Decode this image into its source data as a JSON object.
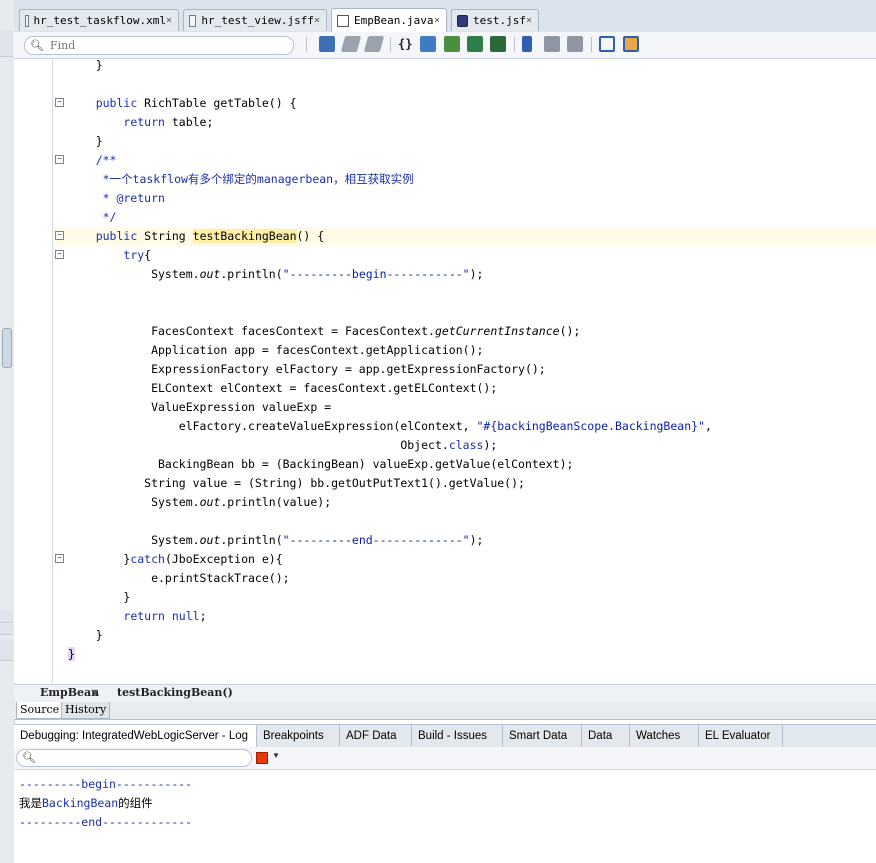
{
  "editor_tabs": [
    {
      "label": "hr_test_taskflow.xml",
      "icon": "xml-file-icon",
      "active": false
    },
    {
      "label": "hr_test_view.jsff",
      "icon": "jsff-file-icon",
      "active": false
    },
    {
      "label": "EmpBean.java",
      "icon": "java-file-icon",
      "active": true
    },
    {
      "label": "test.jsf",
      "icon": "jsf-file-icon",
      "active": false
    }
  ],
  "tab_close_glyph": "×",
  "toolbar": {
    "find_placeholder": "Find",
    "buttons": [
      "toggle-comment-icon",
      "indent-icon",
      "unindent-icon",
      "code-template-icon",
      "surround-icon",
      "refactor-icon",
      "generate-accessors-icon",
      "override-icon",
      "bookmark-icon",
      "next-bookmark-icon",
      "prev-bookmark-icon",
      "show-outline-icon",
      "structure-icon"
    ]
  },
  "code": {
    "lines": [
      "    }",
      "",
      "    public RichTable getTable() {",
      "        return table;",
      "    }",
      "    /**",
      "     *一个taskflow有多个绑定的managerbean，相互获取实例",
      "     * @return",
      "     */",
      "    public String testBackingBean() {",
      "        try{",
      "            System.out.println(\"---------begin-----------\");",
      "",
      "",
      "            FacesContext facesContext = FacesContext.getCurrentInstance();",
      "            Application app = facesContext.getApplication();",
      "            ExpressionFactory elFactory = app.getExpressionFactory();",
      "            ELContext elContext = facesContext.getELContext();",
      "            ValueExpression valueExp =",
      "                elFactory.createValueExpression(elContext, \"#{backingBeanScope.BackingBean}\",",
      "                                                Object.class);",
      "             BackingBean bb = (BackingBean) valueExp.getValue(elContext);",
      "           String value = (String) bb.getOutPutText1().getValue();",
      "            System.out.println(value);",
      "",
      "            System.out.println(\"---------end-------------\");",
      "        }catch(JboException e){",
      "            e.printStackTrace();",
      "        }",
      "        return null;",
      "    }",
      "}"
    ]
  },
  "breadcrumb": [
    "EmpBean",
    "testBackingBean()"
  ],
  "source_tabs": [
    "Source",
    "History"
  ],
  "log_tabs": [
    "Debugging: IntegratedWebLogicServer - Log",
    "Breakpoints",
    "ADF Data",
    "Build - Issues",
    "Smart Data",
    "Data",
    "Watches",
    "EL Evaluator"
  ],
  "log_search_placeholder": "",
  "log_output": [
    "---------begin-----------",
    "我是BackingBean的组件",
    "---------end-------------"
  ],
  "colors": {
    "keyword": "#1d2fa8",
    "string": "#0b1ea8",
    "highlight": "#fffbe6",
    "stop": "#e8370b"
  }
}
